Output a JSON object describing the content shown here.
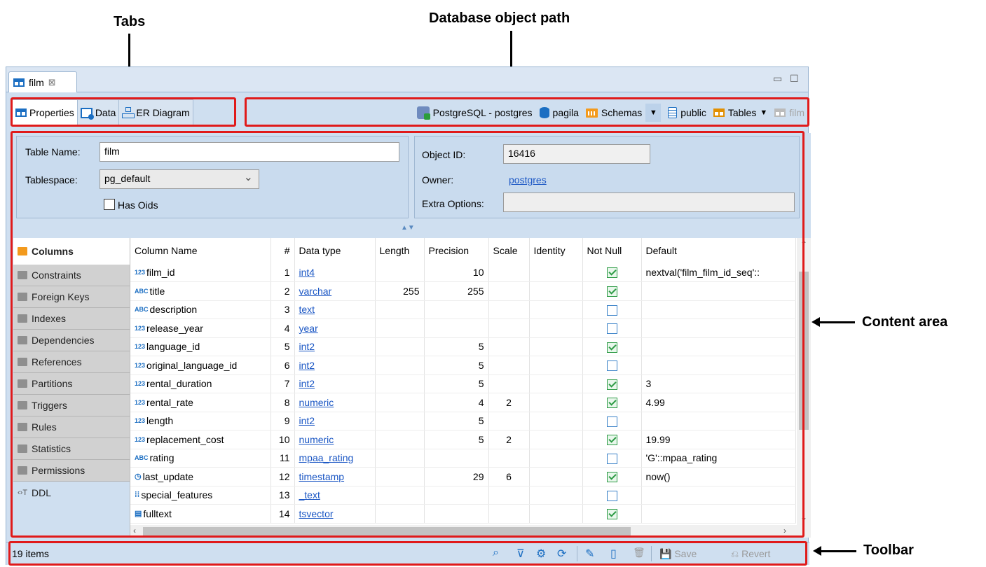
{
  "annotations": {
    "tabs": "Tabs",
    "path": "Database object path",
    "content": "Content area",
    "toolbar": "Toolbar"
  },
  "editor_tab": {
    "label": "film",
    "close": "⊠"
  },
  "window_controls": {
    "minimize": "▭",
    "maximize": "☐"
  },
  "subtabs": [
    "Properties",
    "Data",
    "ER Diagram"
  ],
  "path": {
    "connection": "PostgreSQL - postgres",
    "database": "pagila",
    "schemas": "Schemas",
    "schema": "public",
    "tables": "Tables",
    "table": "film"
  },
  "props": {
    "table_name_label": "Table Name:",
    "table_name": "film",
    "tablespace_label": "Tablespace:",
    "tablespace": "pg_default",
    "has_oids_label": "Has Oids",
    "object_id_label": "Object ID:",
    "object_id": "16416",
    "owner_label": "Owner:",
    "owner": "postgres",
    "extra_options_label": "Extra Options:",
    "extra_options": ""
  },
  "sidenav": [
    "Columns",
    "Constraints",
    "Foreign Keys",
    "Indexes",
    "Dependencies",
    "References",
    "Partitions",
    "Triggers",
    "Rules",
    "Statistics",
    "Permissions",
    "DDL"
  ],
  "grid": {
    "headers": [
      "Column Name",
      "#",
      "Data type",
      "Length",
      "Precision",
      "Scale",
      "Identity",
      "Not Null",
      "Default"
    ],
    "rows": [
      {
        "icon": "123",
        "name": "film_id",
        "n": "1",
        "type": "int4",
        "length": "",
        "precision": "10",
        "scale": "",
        "identity": "",
        "not_null": true,
        "default": "nextval('film_film_id_seq'::"
      },
      {
        "icon": "ABC",
        "name": "title",
        "n": "2",
        "type": "varchar",
        "length": "255",
        "precision": "255",
        "scale": "",
        "identity": "",
        "not_null": true,
        "default": ""
      },
      {
        "icon": "ABC",
        "name": "description",
        "n": "3",
        "type": "text",
        "length": "",
        "precision": "",
        "scale": "",
        "identity": "",
        "not_null": false,
        "default": ""
      },
      {
        "icon": "123",
        "name": "release_year",
        "n": "4",
        "type": "year",
        "length": "",
        "precision": "",
        "scale": "",
        "identity": "",
        "not_null": false,
        "default": ""
      },
      {
        "icon": "123",
        "name": "language_id",
        "n": "5",
        "type": "int2",
        "length": "",
        "precision": "5",
        "scale": "",
        "identity": "",
        "not_null": true,
        "default": ""
      },
      {
        "icon": "123",
        "name": "original_language_id",
        "n": "6",
        "type": "int2",
        "length": "",
        "precision": "5",
        "scale": "",
        "identity": "",
        "not_null": false,
        "default": ""
      },
      {
        "icon": "123",
        "name": "rental_duration",
        "n": "7",
        "type": "int2",
        "length": "",
        "precision": "5",
        "scale": "",
        "identity": "",
        "not_null": true,
        "default": "3"
      },
      {
        "icon": "123",
        "name": "rental_rate",
        "n": "8",
        "type": "numeric",
        "length": "",
        "precision": "4",
        "scale": "2",
        "identity": "",
        "not_null": true,
        "default": "4.99"
      },
      {
        "icon": "123",
        "name": "length",
        "n": "9",
        "type": "int2",
        "length": "",
        "precision": "5",
        "scale": "",
        "identity": "",
        "not_null": false,
        "default": ""
      },
      {
        "icon": "123",
        "name": "replacement_cost",
        "n": "10",
        "type": "numeric",
        "length": "",
        "precision": "5",
        "scale": "2",
        "identity": "",
        "not_null": true,
        "default": "19.99"
      },
      {
        "icon": "ABC",
        "name": "rating",
        "n": "11",
        "type": "mpaa_rating",
        "length": "",
        "precision": "",
        "scale": "",
        "identity": "",
        "not_null": false,
        "default": "'G'::mpaa_rating"
      },
      {
        "icon": "clock-icon",
        "name": "last_update",
        "n": "12",
        "type": "timestamp",
        "length": "",
        "precision": "29",
        "scale": "6",
        "identity": "",
        "not_null": true,
        "default": "now()"
      },
      {
        "icon": "array-icon",
        "name": "special_features",
        "n": "13",
        "type": "_text",
        "length": "",
        "precision": "",
        "scale": "",
        "identity": "",
        "not_null": false,
        "default": ""
      },
      {
        "icon": "document-icon",
        "name": "fulltext",
        "n": "14",
        "type": "tsvector",
        "length": "",
        "precision": "",
        "scale": "",
        "identity": "",
        "not_null": true,
        "default": ""
      }
    ]
  },
  "status": {
    "items": "19 items",
    "save": "Save",
    "revert": "Revert"
  },
  "colors": {
    "highlight": "#e01a1a",
    "link": "#1a56c4",
    "accent": "#1b6ec2"
  }
}
